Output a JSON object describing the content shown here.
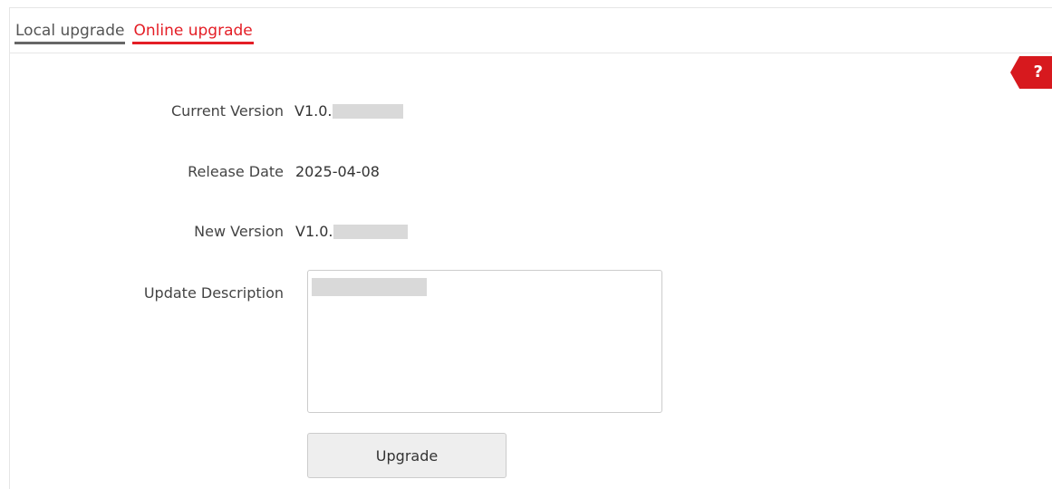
{
  "tabs": [
    {
      "label": "Local upgrade",
      "active": false
    },
    {
      "label": "Online upgrade",
      "active": true
    }
  ],
  "help": {
    "label": "?"
  },
  "fields": {
    "current_version": {
      "label": "Current Version",
      "value": "V1.0."
    },
    "release_date": {
      "label": "Release Date",
      "value": "2025-04-08"
    },
    "new_version": {
      "label": "New Version",
      "value": "V1.0."
    },
    "update_description": {
      "label": "Update Description"
    }
  },
  "actions": {
    "upgrade_label": "Upgrade"
  },
  "colors": {
    "accent": "#e41e26",
    "help_bg": "#d7191e",
    "button_bg": "#eeeeee"
  }
}
